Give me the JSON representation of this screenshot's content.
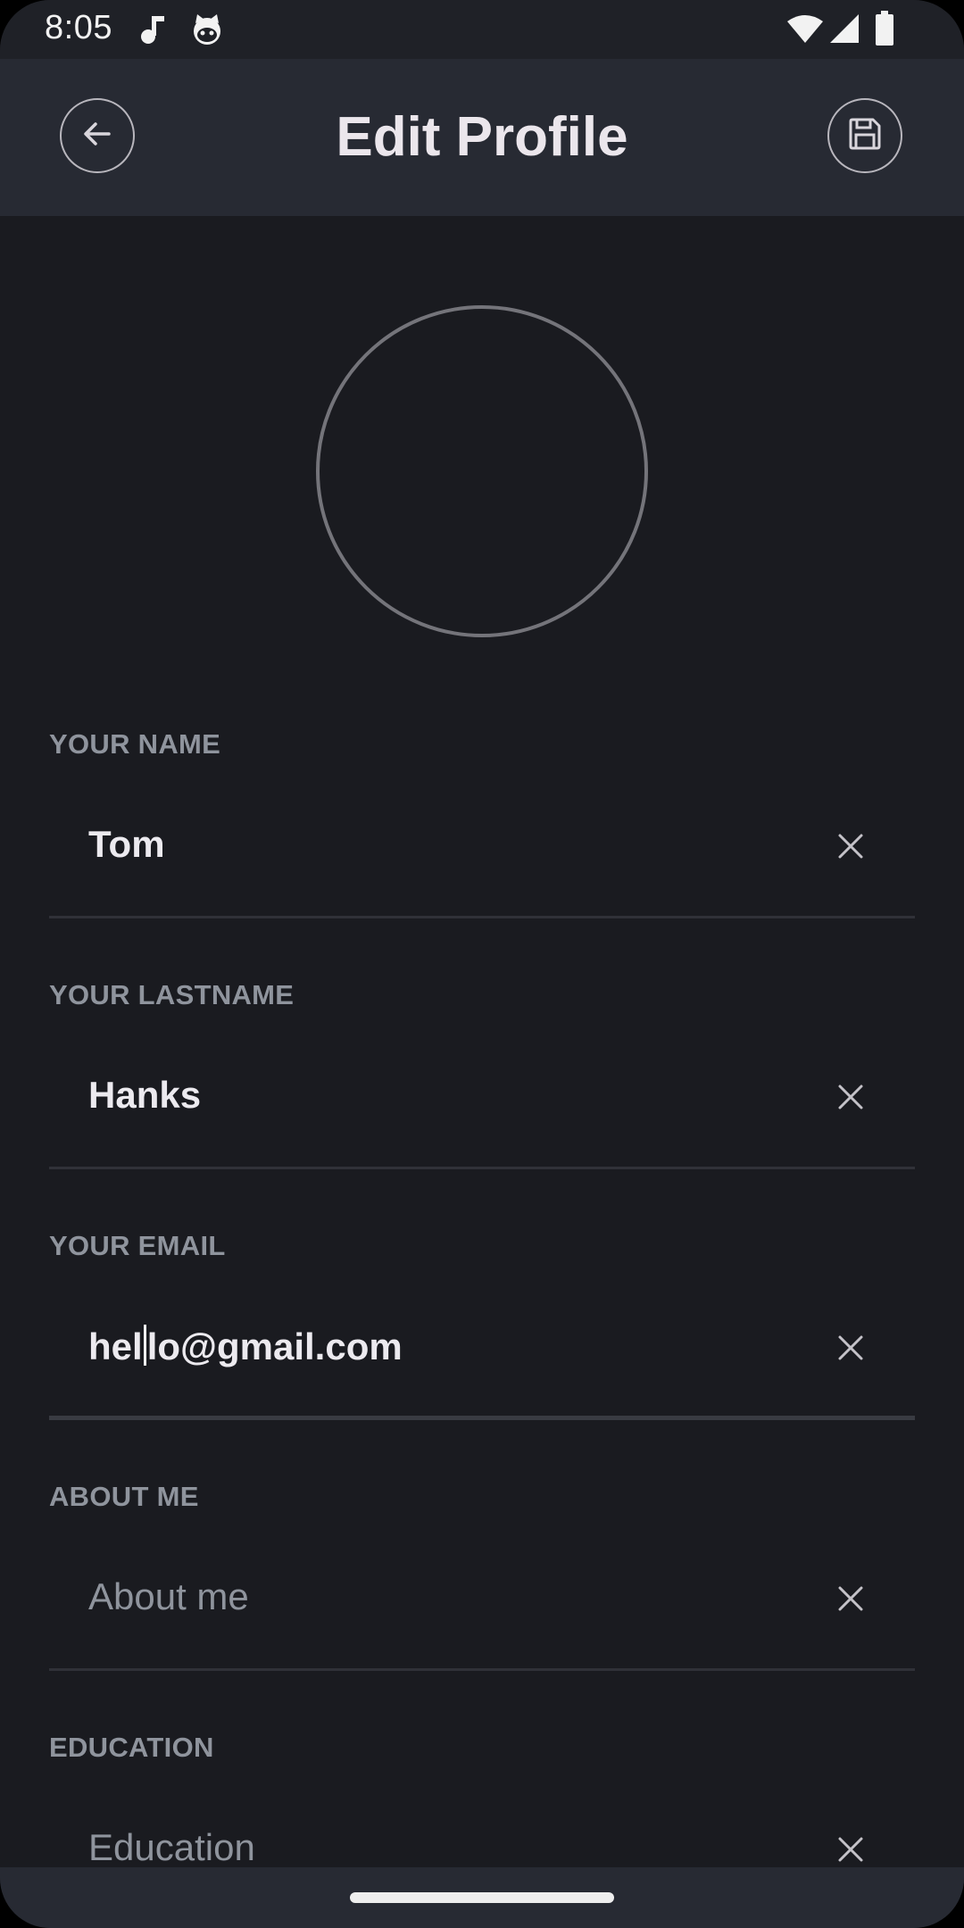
{
  "status_bar": {
    "time": "8:05",
    "left_icons": [
      "music-note-icon",
      "cat-face-icon"
    ],
    "right_icons": [
      "wifi-icon",
      "signal-icon",
      "battery-icon"
    ]
  },
  "app_bar": {
    "title": "Edit Profile",
    "back_icon": "arrow-left-icon",
    "save_icon": "floppy-disk-icon"
  },
  "avatar": {
    "icon": "empty-circle"
  },
  "fields": {
    "name": {
      "label": "YOUR NAME",
      "value": "Tom"
    },
    "lastname": {
      "label": "YOUR LASTNAME",
      "value": "Hanks"
    },
    "email": {
      "label": "YOUR EMAIL",
      "value_before_caret": "hel",
      "value_after_caret": "lo@gmail.com",
      "focused": true
    },
    "about": {
      "label": "ABOUT ME",
      "placeholder": "About me"
    },
    "education": {
      "label": "EDUCATION",
      "placeholder": "Education"
    }
  },
  "colors": {
    "background": "#1a1b20",
    "app_bar": "#272a33",
    "label": "#8f949d",
    "text": "#eceaef"
  }
}
